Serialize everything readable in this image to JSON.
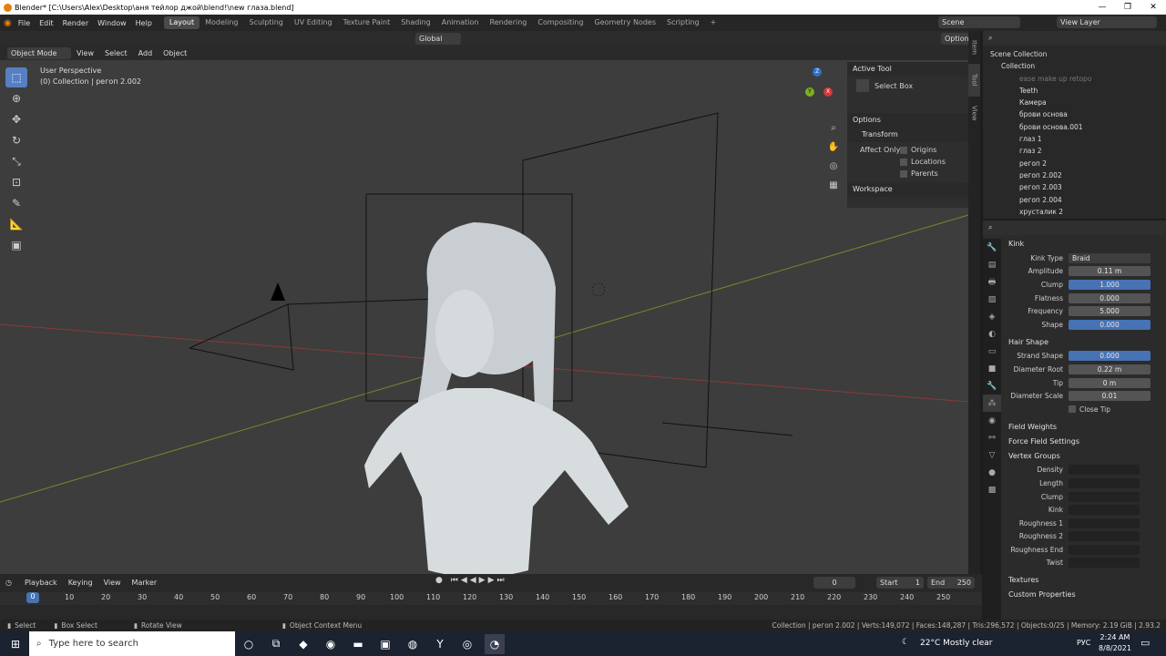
{
  "window": {
    "title": "Blender* [C:\\Users\\Alex\\Desktop\\аня тейлор джой\\blend!\\new глаза.blend]",
    "minimize": "—",
    "maximize": "❐",
    "close": "✕"
  },
  "menus": [
    "File",
    "Edit",
    "Render",
    "Window",
    "Help"
  ],
  "workspace_tabs": [
    "Layout",
    "Modeling",
    "Sculpting",
    "UV Editing",
    "Texture Paint",
    "Shading",
    "Animation",
    "Rendering",
    "Compositing",
    "Geometry Nodes",
    "Scripting"
  ],
  "workspace_add": "+",
  "scene": {
    "label": "Scene",
    "view_layer": "View Layer"
  },
  "header_tools": {
    "transform": "Global",
    "options": "Options"
  },
  "viewport": {
    "mode": "Object Mode",
    "menus": [
      "View",
      "Select",
      "Add",
      "Object"
    ],
    "perspective": "User Perspective",
    "collection": "(0) Collection | регоп 2.002",
    "axes": {
      "x": "X",
      "y": "Y",
      "z": "Z"
    }
  },
  "npanel": {
    "active_tool": "Active Tool",
    "select_box": "Select Box",
    "options": "Options",
    "transform": "Transform",
    "affect_only": "Affect Only",
    "origins": "Origins",
    "locations": "Locations",
    "parents": "Parents",
    "workspace": "Workspace",
    "tabs": [
      "Item",
      "Tool",
      "View"
    ]
  },
  "outliner": {
    "scene_collection": "Scene Collection",
    "collection": "Collection",
    "items": [
      "ease make up retopo",
      "Teeth",
      "Камера",
      "брови основа",
      "брови основа.001",
      "глаз 1",
      "глаз 2",
      "регоп 2",
      "регоп 2.002",
      "регоп 2.003",
      "регоп 2.004",
      "хрусталик 2"
    ]
  },
  "properties": {
    "kink_section": "Kink",
    "kink_type_label": "Kink Type",
    "kink_type": "Braid",
    "kink_rows": [
      {
        "label": "Amplitude",
        "value": "0.11 m",
        "highlight": false
      },
      {
        "label": "Clump",
        "value": "1.000",
        "highlight": true
      },
      {
        "label": "Flatness",
        "value": "0.000",
        "highlight": false
      },
      {
        "label": "Frequency",
        "value": "5.000",
        "highlight": false
      },
      {
        "label": "Shape",
        "value": "0.000",
        "highlight": true
      }
    ],
    "hair_shape_section": "Hair Shape",
    "hair_rows": [
      {
        "label": "Strand Shape",
        "value": "0.000",
        "highlight": true
      },
      {
        "label": "Diameter Root",
        "value": "0.22 m",
        "highlight": false
      },
      {
        "label": "Tip",
        "value": "0 m",
        "highlight": false
      },
      {
        "label": "Diameter Scale",
        "value": "0.01",
        "highlight": false
      }
    ],
    "close_tip": "Close Tip",
    "field_weights": "Field Weights",
    "force_field": "Force Field Settings",
    "vertex_groups": "Vertex Groups",
    "vg_rows": [
      "Density",
      "Length",
      "Clump",
      "Kink",
      "Roughness 1",
      "Roughness 2",
      "Roughness End",
      "Twist"
    ],
    "textures": "Textures",
    "custom_props": "Custom Properties"
  },
  "timeline": {
    "menus": [
      "Playback",
      "Keying",
      "View",
      "Marker"
    ],
    "current": "0",
    "start_label": "Start",
    "start": "1",
    "end_label": "End",
    "end": "250",
    "ticks": [
      "0",
      "10",
      "20",
      "30",
      "40",
      "50",
      "60",
      "70",
      "80",
      "90",
      "100",
      "110",
      "120",
      "130",
      "140",
      "150",
      "160",
      "170",
      "180",
      "190",
      "200",
      "210",
      "220",
      "230",
      "240",
      "250"
    ]
  },
  "statusbar": {
    "select": "Select",
    "box_select": "Box Select",
    "rotate_view": "Rotate View",
    "context_menu": "Object Context Menu",
    "info": "Collection | регоп 2.002 | Verts:149,072 | Faces:148,287 | Tris:296,572 | Objects:0/25 | Memory: 2.19 GiB | 2.93.2"
  },
  "taskbar": {
    "search": "Type here to search",
    "weather": "22°C  Mostly clear",
    "lang": "РУС",
    "time": "2:24 AM",
    "date": "8/8/2021"
  }
}
